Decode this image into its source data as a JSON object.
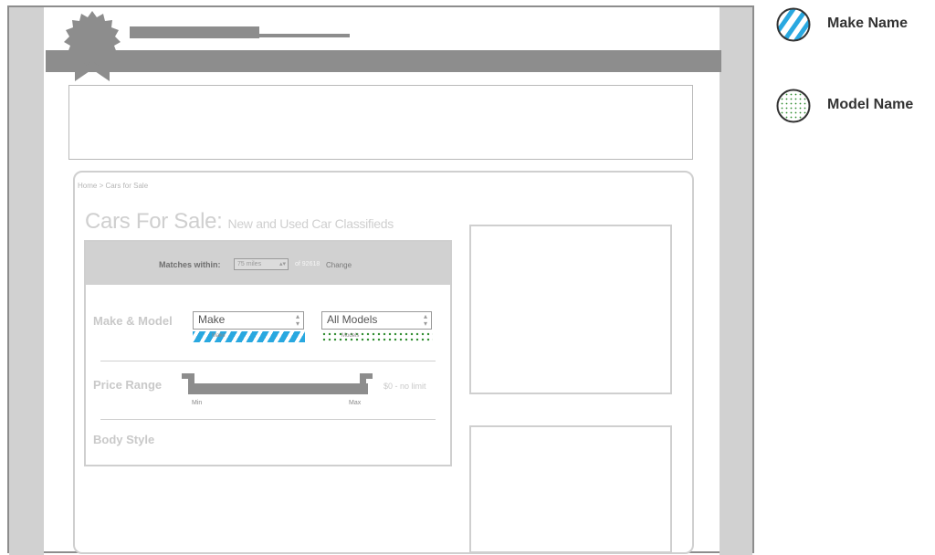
{
  "header": {
    "logo_icon": "ribbon-badge-icon"
  },
  "breadcrumb": "Home > Cars for Sale",
  "page_title": {
    "main": "Cars For Sale:",
    "sub": "New and Used Car Classifieds"
  },
  "matches": {
    "label": "Matches within:",
    "radius_value": "75 miles",
    "zip_text": "of 92618",
    "change_label": "Change"
  },
  "form": {
    "make_model_label": "Make & Model",
    "make_select_value": "Make",
    "model_select_value": "All Models",
    "make_caption": "Make",
    "model_caption": "Models",
    "price_label": "Price Range",
    "price_min_label": "Min",
    "price_max_label": "Max",
    "price_value": "$0 - no limit",
    "body_style_label": "Body Style"
  },
  "legend": {
    "make_label": "Make Name",
    "model_label": "Model Name",
    "make_icon": "blue-striped-circle-icon",
    "model_icon": "green-dotted-circle-icon"
  },
  "colors": {
    "make_accent": "#29a8e0",
    "model_accent": "#2e8b2e",
    "wire_gray": "#8d8d8d",
    "light_gray": "#d1d1d1"
  }
}
